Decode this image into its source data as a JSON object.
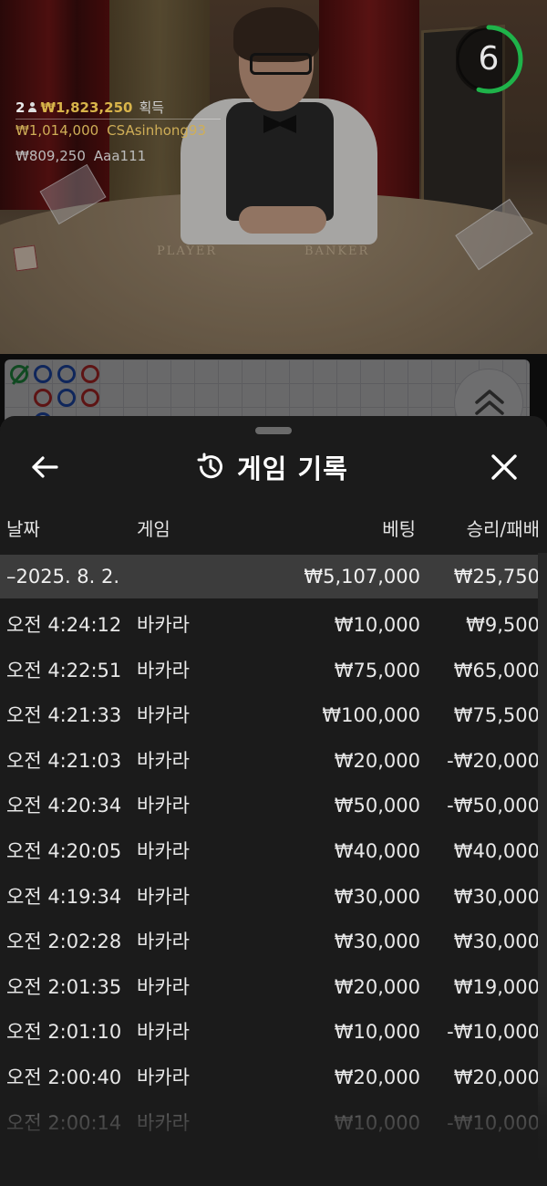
{
  "live": {
    "winners": {
      "count": "2",
      "total": "₩1,823,250",
      "label": "획득",
      "list": [
        {
          "amount": "₩1,014,000",
          "name": "CSAsinhong93"
        },
        {
          "amount": "₩809,250",
          "name": "Aaa111"
        }
      ]
    },
    "timer": {
      "value": "6",
      "fraction": 0.55
    },
    "table_labels": {
      "player": "PLAYER",
      "banker": "BANKER"
    }
  },
  "history": {
    "title": "게임 기록",
    "columns": {
      "date": "날짜",
      "game": "게임",
      "bet": "베팅",
      "win": "승리/패배"
    },
    "day": {
      "date": "–2025. 8. 2.",
      "bet": "₩5,107,000",
      "win": "₩25,750"
    },
    "rows": [
      {
        "time": "오전 4:24:12",
        "game": "바카라",
        "bet": "₩10,000",
        "win": "₩9,500"
      },
      {
        "time": "오전 4:22:51",
        "game": "바카라",
        "bet": "₩75,000",
        "win": "₩65,000"
      },
      {
        "time": "오전 4:21:33",
        "game": "바카라",
        "bet": "₩100,000",
        "win": "₩75,500"
      },
      {
        "time": "오전 4:21:03",
        "game": "바카라",
        "bet": "₩20,000",
        "win": "-₩20,000"
      },
      {
        "time": "오전 4:20:34",
        "game": "바카라",
        "bet": "₩50,000",
        "win": "-₩50,000"
      },
      {
        "time": "오전 4:20:05",
        "game": "바카라",
        "bet": "₩40,000",
        "win": "₩40,000"
      },
      {
        "time": "오전 4:19:34",
        "game": "바카라",
        "bet": "₩30,000",
        "win": "₩30,000"
      },
      {
        "time": "오전 2:02:28",
        "game": "바카라",
        "bet": "₩30,000",
        "win": "₩30,000"
      },
      {
        "time": "오전 2:01:35",
        "game": "바카라",
        "bet": "₩20,000",
        "win": "₩19,000"
      },
      {
        "time": "오전 2:01:10",
        "game": "바카라",
        "bet": "₩10,000",
        "win": "-₩10,000"
      },
      {
        "time": "오전 2:00:40",
        "game": "바카라",
        "bet": "₩20,000",
        "win": "₩20,000"
      },
      {
        "time": "오전 2:00:14",
        "game": "바카라",
        "bet": "₩10,000",
        "win": "-₩10,000"
      }
    ]
  },
  "icons": {
    "back": "arrow-left-icon",
    "history": "history-clock-icon",
    "close": "close-icon",
    "expand": "chevron-double-up-icon",
    "winners": "person-icon"
  },
  "colors": {
    "gold": "#d8b44a",
    "timer_ring": "#1fb34a",
    "banker_red": "#cf2d2d",
    "player_blue": "#2356c9",
    "tie_green": "#25a34a",
    "sheet_bg": "#1b1b1b",
    "day_row_bg": "#3c3c3c"
  }
}
